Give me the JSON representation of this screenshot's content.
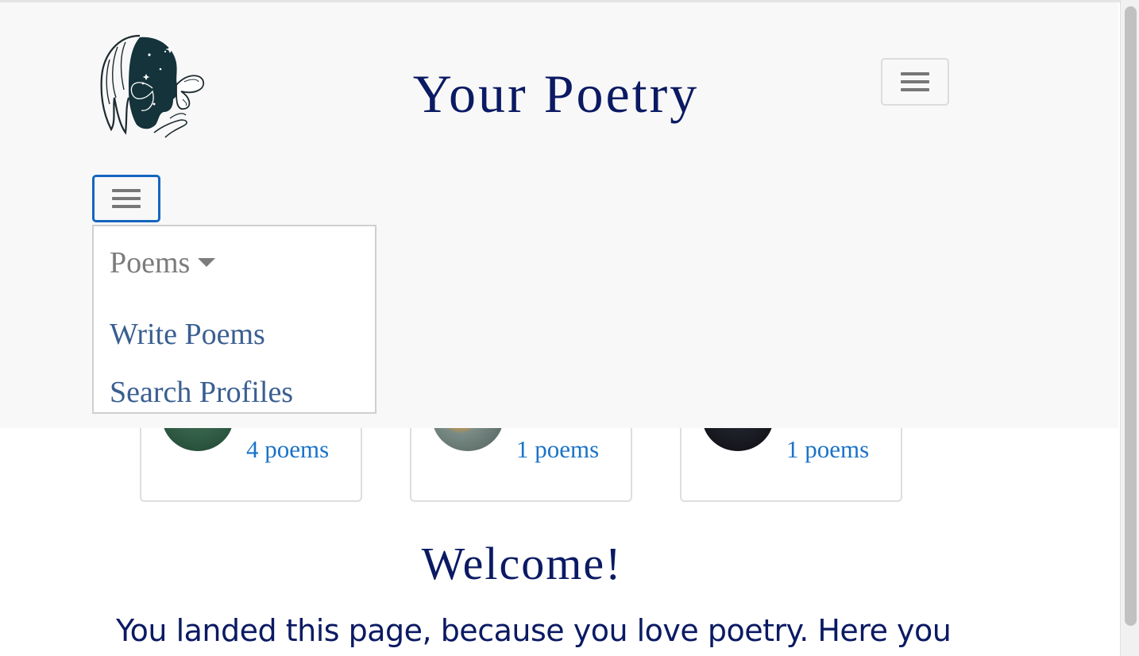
{
  "header": {
    "title": "Your Poetry",
    "logo_icon": "woman-butterfly-logo-icon",
    "title_color": "#0b1a63"
  },
  "nav": {
    "toggle_icon": "hamburger-menu-icon",
    "menu": {
      "poems_label": "Poems",
      "write_label": "Write Poems",
      "search_label": "Search Profiles"
    }
  },
  "profiles": [
    {
      "count_label": "4 poems",
      "avatar_color": "#2c5a44"
    },
    {
      "count_label": "1 poems",
      "avatar_color": "#6d7e78"
    },
    {
      "count_label": "1 poems",
      "avatar_color": "#1a1a1f"
    }
  ],
  "main": {
    "welcome": "Welcome!",
    "intro": "You landed this page, because you love poetry. Here you"
  },
  "colors": {
    "accent": "#1565c0",
    "link": "#1a73c9",
    "menu_link": "#3a5f91"
  }
}
